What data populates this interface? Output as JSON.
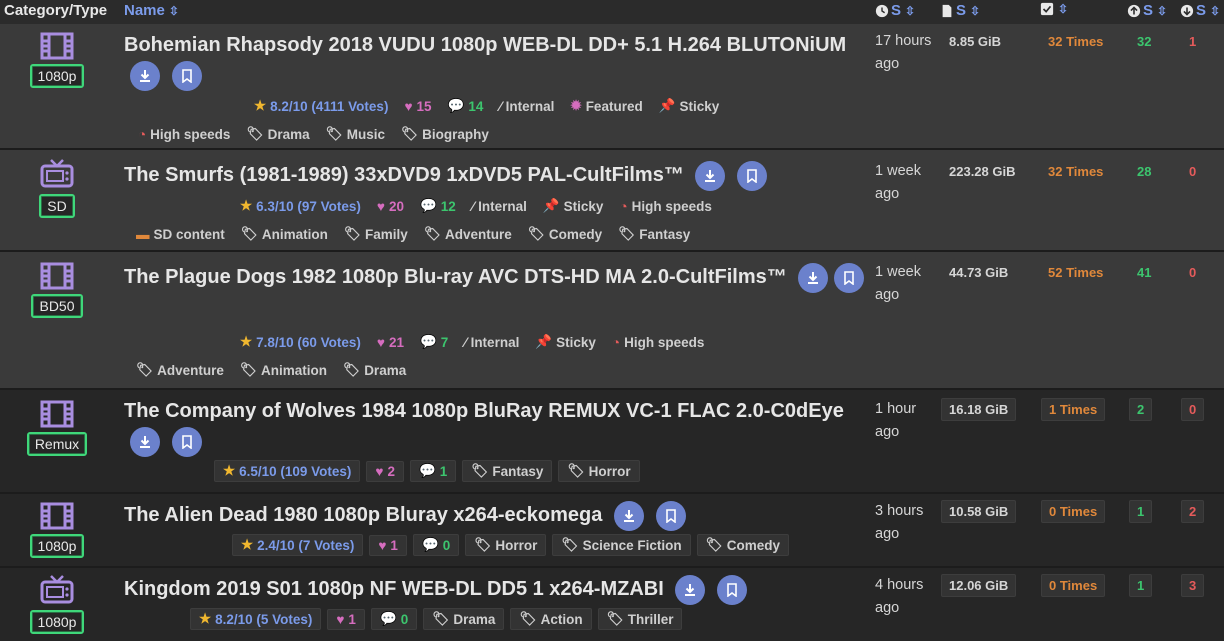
{
  "header": {
    "category_type": "Category/Type",
    "name": "Name",
    "s": "S"
  },
  "rows": [
    {
      "category": "1080p",
      "category_icon": "film-icon",
      "title": "Bohemian Rhapsody 2018 VUDU 1080p WEB-DL DD+ 5.1 H.264 BLUTONiUM",
      "rating": "8.2/10 (4111 Votes)",
      "likes": "15",
      "comments": "14",
      "flags": [
        "Internal",
        "Featured",
        "Sticky"
      ],
      "extras": [
        "High speeds"
      ],
      "genres": [
        "Drama",
        "Music",
        "Biography"
      ],
      "time": "17 hours ago",
      "size": "8.85 GiB",
      "snatched": "32 Times",
      "seeders": "32",
      "leechers": "1"
    },
    {
      "category": "SD",
      "category_icon": "tv-icon",
      "title": "The Smurfs (1981-1989) 33xDVD9 1xDVD5 PAL-CultFilms™",
      "rating": "6.3/10 (97 Votes)",
      "likes": "20",
      "comments": "12",
      "flags": [
        "Internal",
        "Sticky",
        "High speeds"
      ],
      "extras": [
        "SD content"
      ],
      "genres": [
        "Animation",
        "Family",
        "Adventure",
        "Comedy",
        "Fantasy"
      ],
      "time": "1 week ago",
      "size": "223.28 GiB",
      "snatched": "32 Times",
      "seeders": "28",
      "leechers": "0"
    },
    {
      "category": "BD50",
      "category_icon": "film-icon",
      "title": "The Plague Dogs 1982 1080p Blu-ray AVC DTS-HD MA 2.0-CultFilms™",
      "rating": "7.8/10 (60 Votes)",
      "likes": "21",
      "comments": "7",
      "flags": [
        "Internal",
        "Sticky",
        "High speeds"
      ],
      "genres": [
        "Adventure",
        "Animation",
        "Drama"
      ],
      "time": "1 week ago",
      "size": "44.73 GiB",
      "snatched": "52 Times",
      "seeders": "41",
      "leechers": "0"
    },
    {
      "category": "Remux",
      "category_icon": "film-icon",
      "title": "The Company of Wolves 1984 1080p BluRay REMUX VC-1 FLAC 2.0-C0dEye",
      "rating": "6.5/10 (109 Votes)",
      "likes": "2",
      "comments": "1",
      "genres": [
        "Fantasy",
        "Horror"
      ],
      "time": "1 hour ago",
      "size": "16.18 GiB",
      "snatched": "1 Times",
      "seeders": "2",
      "leechers": "0"
    },
    {
      "category": "1080p",
      "category_icon": "film-icon",
      "title": "The Alien Dead 1980 1080p Bluray x264-eckomega",
      "rating": "2.4/10 (7 Votes)",
      "likes": "1",
      "comments": "0",
      "genres": [
        "Horror",
        "Science Fiction",
        "Comedy"
      ],
      "time": "3 hours ago",
      "size": "10.58 GiB",
      "snatched": "0 Times",
      "seeders": "1",
      "leechers": "2"
    },
    {
      "category": "1080p",
      "category_icon": "tv-icon",
      "title": "Kingdom 2019 S01 1080p NF WEB-DL DD5 1 x264-MZABI",
      "rating": "8.2/10 (5 Votes)",
      "likes": "1",
      "comments": "0",
      "genres": [
        "Drama",
        "Action",
        "Thriller"
      ],
      "time": "4 hours ago",
      "size": "12.06 GiB",
      "snatched": "0 Times",
      "seeders": "1",
      "leechers": "3"
    }
  ],
  "colors": {
    "accent": "#7b9bea",
    "badge_border": "#3fd77a",
    "snatched": "#e0883b",
    "seeders": "#3cc56e",
    "leechers": "#e55b5b",
    "likes": "#d66dbf",
    "icon_purple": "#a98ee0"
  }
}
